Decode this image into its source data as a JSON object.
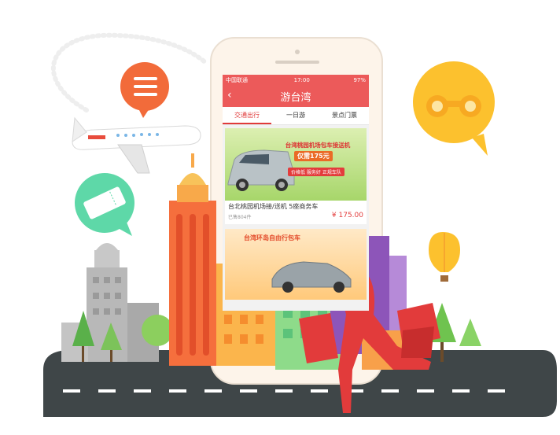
{
  "status_bar": {
    "carrier": "中国联通",
    "time": "17:00",
    "battery": "97%"
  },
  "nav": {
    "title": "游台湾",
    "back_icon": "chevron-left-icon"
  },
  "tabs": [
    {
      "label": "交通出行",
      "active": true
    },
    {
      "label": "一日游",
      "active": false
    },
    {
      "label": "景点门票",
      "active": false
    }
  ],
  "product": {
    "banner_title": "台湾桃园机场包车接送机",
    "banner_price": "仅需175元",
    "banner_tag": "价格低 服务好 正规车队",
    "title": "台北桃园机场接/送机 5座商务车",
    "sold": "已售804件",
    "price": "¥ 175.00"
  },
  "product2": {
    "banner_title": "台湾环岛自由行包车"
  },
  "colors": {
    "brand": "#ec5a5a",
    "accent": "#e33c3c"
  },
  "decorations": {
    "left_icon": "menu-chat-icon",
    "ticket_icon": "ticket-chat-icon",
    "right_icon": "binoculars-icon",
    "balloon": "hot-air-balloon-icon"
  }
}
